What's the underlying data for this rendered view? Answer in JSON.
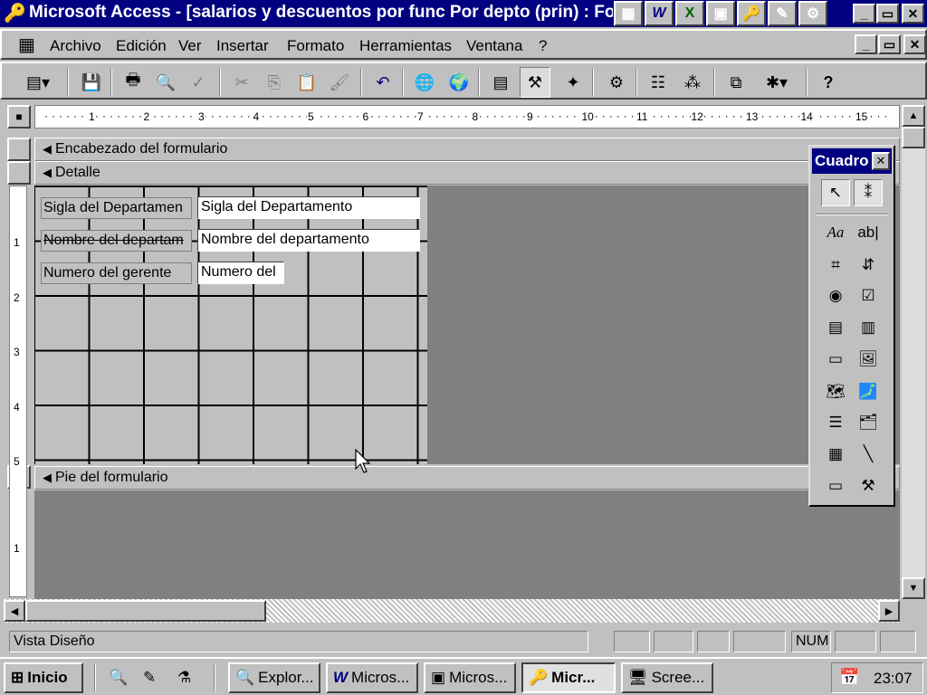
{
  "window": {
    "title": "Microsoft Access - [salarios y descuentos por func Por depto (prin) : Fo",
    "app_icon": "key-icon",
    "tray_apps": [
      {
        "label": "W",
        "icon": "word-icon"
      },
      {
        "label": "X",
        "icon": "excel-icon"
      },
      {
        "label": "▣",
        "icon": "powerpoint-icon"
      },
      {
        "label": "🔑",
        "icon": "access-icon"
      },
      {
        "label": "✎",
        "icon": "pen-icon"
      },
      {
        "label": "⚙",
        "icon": "setup-icon"
      }
    ],
    "buttons": [
      "_",
      "▭",
      "✕"
    ]
  },
  "menu": {
    "items": [
      "Archivo",
      "Edición",
      "Ver",
      "Insertar",
      "Formato",
      "Herramientas",
      "Ventana",
      "?"
    ],
    "doc_buttons": [
      "_",
      "▭",
      "✕"
    ]
  },
  "toolbar": {
    "buttons": [
      {
        "name": "form-view",
        "glyph": "▤▾"
      },
      {
        "name": "save",
        "glyph": "💾"
      },
      {
        "name": "print",
        "glyph": "🖶"
      },
      {
        "name": "print-preview",
        "glyph": "🔍"
      },
      {
        "name": "spelling",
        "glyph": "✓"
      },
      {
        "name": "cut",
        "glyph": "✂"
      },
      {
        "name": "copy",
        "glyph": "⎘"
      },
      {
        "name": "paste",
        "glyph": "📋"
      },
      {
        "name": "format-painter",
        "glyph": "🖌"
      },
      {
        "name": "undo",
        "glyph": "↶"
      },
      {
        "name": "insert-hyperlink",
        "glyph": "🌐"
      },
      {
        "name": "web-toolbar",
        "glyph": "🌍"
      },
      {
        "name": "field-list",
        "glyph": "▤"
      },
      {
        "name": "toolbox",
        "glyph": "⚒"
      },
      {
        "name": "autoformat",
        "glyph": "✦"
      },
      {
        "name": "code",
        "glyph": "⚙"
      },
      {
        "name": "properties",
        "glyph": "☷"
      },
      {
        "name": "build",
        "glyph": "⁂"
      },
      {
        "name": "database-window",
        "glyph": "⧉"
      },
      {
        "name": "new-object",
        "glyph": "✱▾"
      },
      {
        "name": "help",
        "glyph": "?"
      }
    ]
  },
  "ruler": {
    "h_labels": [
      "1",
      "2",
      "3",
      "4",
      "5",
      "6",
      "7",
      "8",
      "9",
      "10",
      "11",
      "12",
      "13",
      "14",
      "15"
    ],
    "v_labels_detail": [
      "1",
      "2",
      "3",
      "4",
      "5"
    ],
    "v_labels_footer": [
      "1"
    ]
  },
  "sections": {
    "header": "Encabezado del formulario",
    "detail": "Detalle",
    "footer": "Pie del formulario"
  },
  "form": {
    "labels": [
      "Sigla del Departamen",
      "Nombre del departam",
      "Numero del gerente"
    ],
    "fields": [
      "Sigla del Departamento",
      "Nombre del departamento",
      "Numero del"
    ]
  },
  "toolbox": {
    "title": "Cuadro",
    "tools": [
      {
        "name": "select-objects",
        "glyph": "↖"
      },
      {
        "name": "control-wizards",
        "glyph": "⁑"
      },
      {
        "name": "label",
        "glyph": "Aa"
      },
      {
        "name": "text-box",
        "glyph": "ab|"
      },
      {
        "name": "option-group",
        "glyph": "⌗"
      },
      {
        "name": "toggle-button",
        "glyph": "⇵"
      },
      {
        "name": "option-button",
        "glyph": "◉"
      },
      {
        "name": "check-box",
        "glyph": "☑"
      },
      {
        "name": "combo-box",
        "glyph": "▤"
      },
      {
        "name": "list-box",
        "glyph": "▥"
      },
      {
        "name": "command-button",
        "glyph": "▭"
      },
      {
        "name": "image",
        "glyph": "🖼"
      },
      {
        "name": "unbound-object-frame",
        "glyph": "🗺"
      },
      {
        "name": "bound-object-frame",
        "glyph": "🗾"
      },
      {
        "name": "page-break",
        "glyph": "☰"
      },
      {
        "name": "tab-control",
        "glyph": "🗂"
      },
      {
        "name": "subform",
        "glyph": "▦"
      },
      {
        "name": "line",
        "glyph": "╲"
      },
      {
        "name": "rectangle",
        "glyph": "▭"
      },
      {
        "name": "more-controls",
        "glyph": "⚒"
      }
    ]
  },
  "status": {
    "text": "Vista Diseño",
    "num": "NUM"
  },
  "taskbar": {
    "start": "Inicio",
    "quick_launch": [
      "🔍",
      "✎",
      "⚗"
    ],
    "tasks": [
      {
        "label": "Explor...",
        "icon": "explorer-icon",
        "glyph": "🔍",
        "active": false
      },
      {
        "label": "Micros...",
        "icon": "word-icon",
        "glyph": "W",
        "active": false
      },
      {
        "label": "Micros...",
        "icon": "powerpoint-icon",
        "glyph": "▣",
        "active": false
      },
      {
        "label": "Micr...",
        "icon": "access-icon",
        "glyph": "🔑",
        "active": true
      },
      {
        "label": "Scree...",
        "icon": "screen-icon",
        "glyph": "🖥",
        "active": false
      }
    ],
    "clock": "23:07"
  }
}
